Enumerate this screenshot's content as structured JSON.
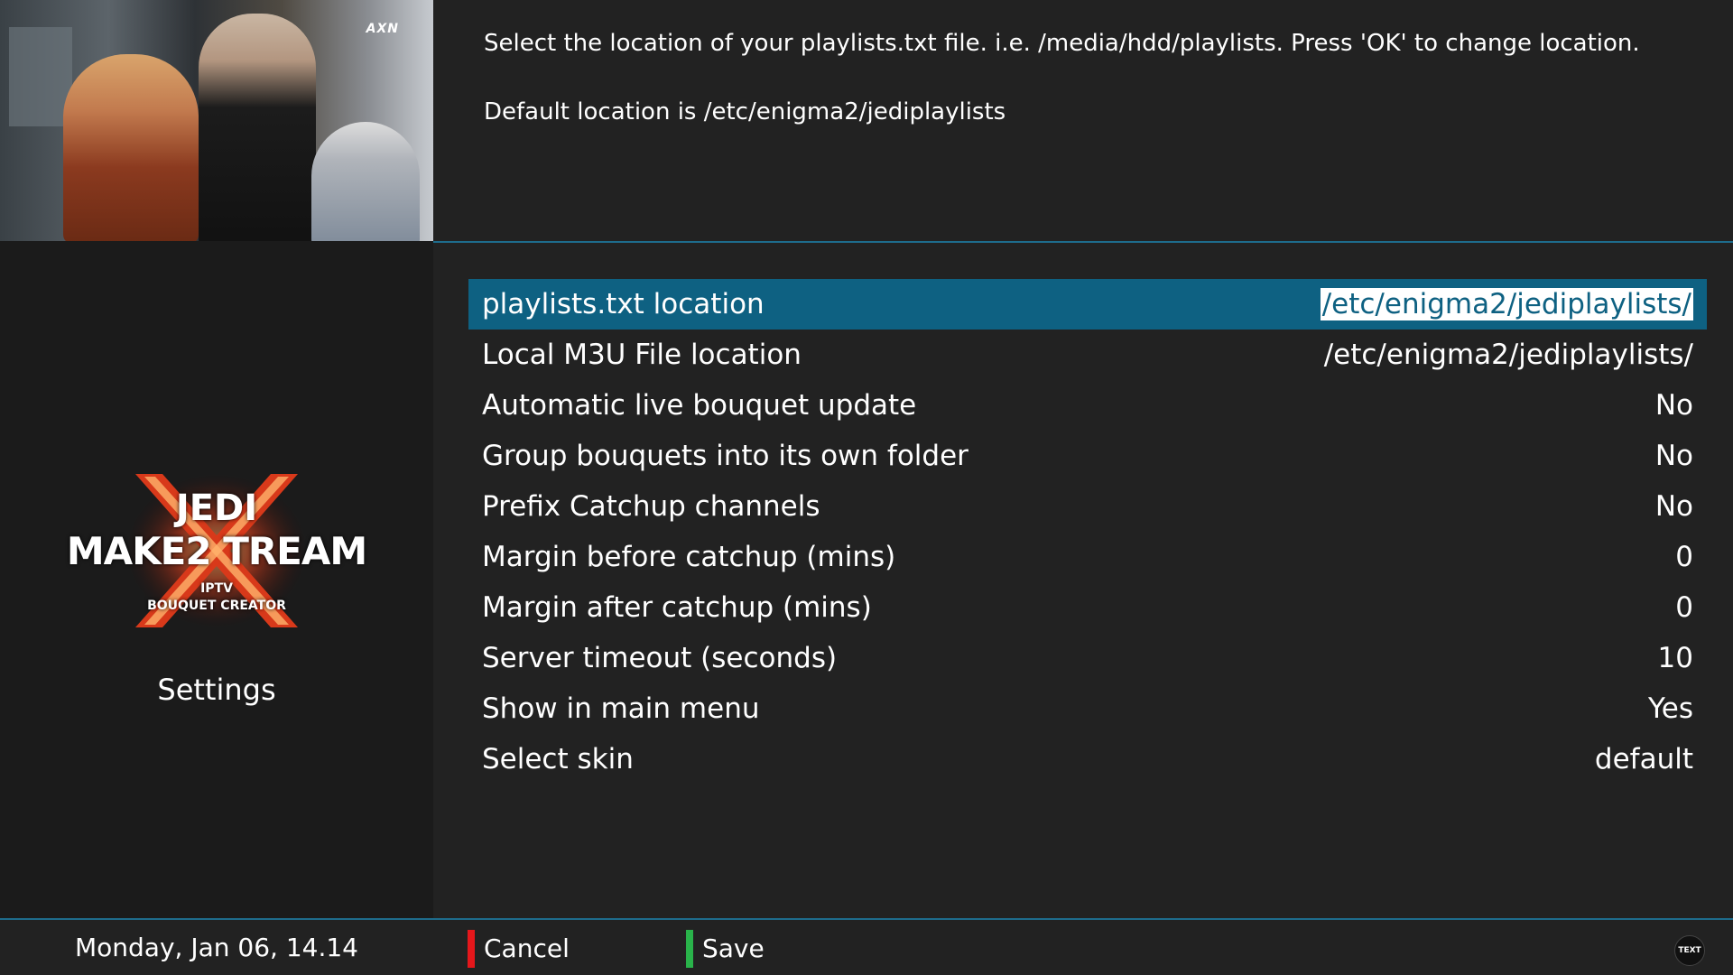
{
  "header": {
    "description_line1": "Select the location of your playlists.txt file. i.e. /media/hdd/playlists. Press 'OK' to change location.",
    "description_line2": "Default location is /etc/enigma2/jediplaylists"
  },
  "preview": {
    "channel_logo": "AXN"
  },
  "sidebar": {
    "logo": {
      "line1": "JEDI",
      "line2": "MAKE2 TREAM",
      "line3": "IPTV",
      "line4": "BOUQUET CREATOR"
    },
    "title": "Settings"
  },
  "settings": [
    {
      "label": "playlists.txt location",
      "value": "/etc/enigma2/jediplaylists/"
    },
    {
      "label": "Local M3U File location",
      "value": "/etc/enigma2/jediplaylists/"
    },
    {
      "label": "Automatic live bouquet update",
      "value": "No"
    },
    {
      "label": "Group bouquets into its own folder",
      "value": "No"
    },
    {
      "label": "Prefix Catchup channels",
      "value": "No"
    },
    {
      "label": "Margin before catchup (mins)",
      "value": "0"
    },
    {
      "label": "Margin after catchup (mins)",
      "value": "0"
    },
    {
      "label": "Server timeout (seconds)",
      "value": "10"
    },
    {
      "label": "Show in main menu",
      "value": "Yes"
    },
    {
      "label": "Select skin",
      "value": "default"
    }
  ],
  "footer": {
    "datetime": "Monday, Jan 06, 14.14",
    "cancel_label": "Cancel",
    "save_label": "Save",
    "text_button": "TEXT"
  },
  "colors": {
    "accent": "#0e6182",
    "divider": "#1e6c8c",
    "red_key": "#e5171b",
    "green_key": "#29b34a"
  }
}
